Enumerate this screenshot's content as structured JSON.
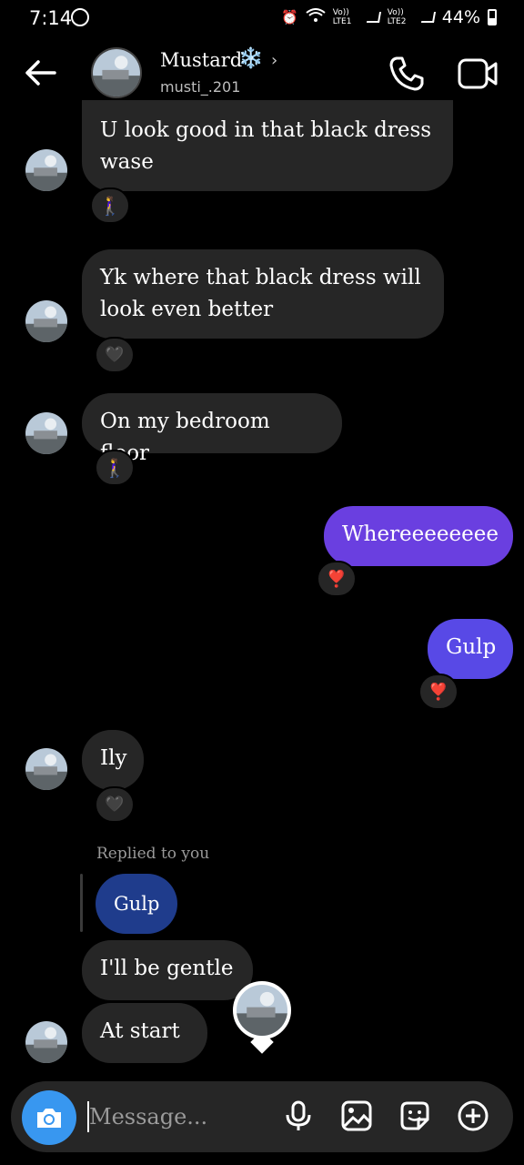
{
  "status": {
    "time": "7:14",
    "battery": "44%",
    "net1": "Vo)) LTE1",
    "net2": "Vo)) LTE2"
  },
  "header": {
    "name": "Mustard",
    "emoji": "❄️",
    "handle": "musti_.201"
  },
  "messages": [
    {
      "text1": "U look good in that black dress",
      "text2": "wase",
      "reaction": "🚶‍♀️"
    },
    {
      "text1": "Yk where that black dress will",
      "text2": "look even better",
      "reaction": "🖤"
    },
    {
      "text1": "On my bedroom floor",
      "reaction": "🚶‍♀️"
    },
    {
      "text1": "Whereeeeeeee",
      "reaction": "❣️"
    },
    {
      "text1": "Gulp",
      "reaction": "❣️"
    },
    {
      "text1": "Ily",
      "reaction": "🖤"
    },
    {
      "text1": "I'll be gentle"
    },
    {
      "text1": "At start"
    }
  ],
  "reply": {
    "label": "Replied to you",
    "quoted": "Gulp"
  },
  "composer": {
    "placeholder": "Message..."
  },
  "colors": {
    "out_bubble_1": "#6a3fe0",
    "out_bubble_2": "#5849e6",
    "reply_bubble": "#1f3c8c",
    "camera": "#3897f0",
    "incoming": "#262626"
  }
}
